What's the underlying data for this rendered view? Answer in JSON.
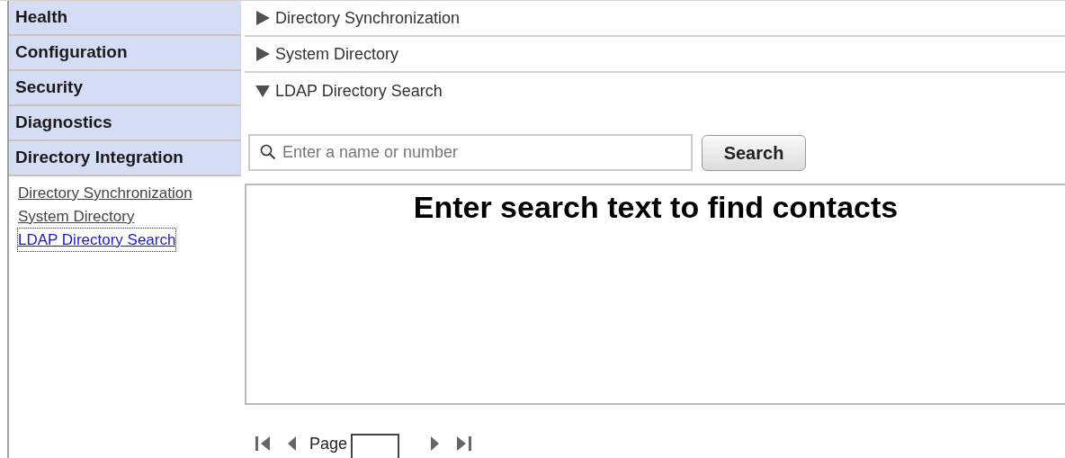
{
  "sidebar": {
    "sections": [
      {
        "label": "Health"
      },
      {
        "label": "Configuration"
      },
      {
        "label": "Security"
      },
      {
        "label": "Diagnostics"
      },
      {
        "label": "Directory Integration"
      }
    ],
    "links": [
      {
        "label": "Directory Synchronization",
        "selected": false
      },
      {
        "label": "System Directory",
        "selected": false
      },
      {
        "label": "LDAP Directory Search",
        "selected": true
      }
    ]
  },
  "panels": [
    {
      "title": "Directory Synchronization",
      "expanded": false
    },
    {
      "title": "System Directory",
      "expanded": false
    },
    {
      "title": "LDAP Directory Search",
      "expanded": true
    }
  ],
  "search": {
    "placeholder": "Enter a name or number",
    "button": "Search"
  },
  "results": {
    "message": "Enter search text to find contacts"
  },
  "pager": {
    "label": "Page"
  }
}
